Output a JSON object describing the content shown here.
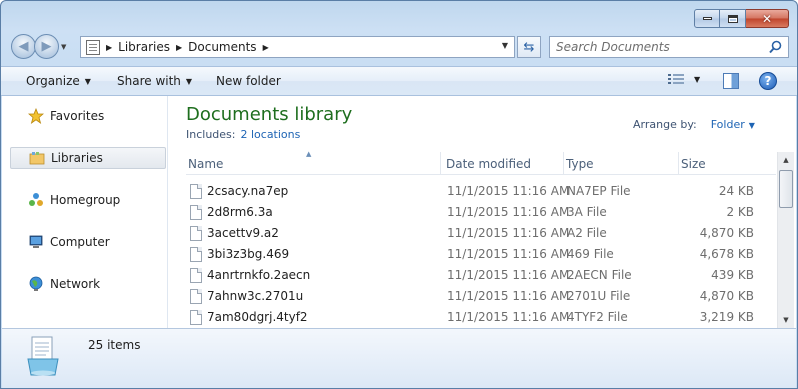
{
  "address": {
    "crumbs": [
      "Libraries",
      "Documents"
    ],
    "search_placeholder": "Search Documents"
  },
  "toolbar": {
    "organize": "Organize",
    "share_with": "Share with",
    "new_folder": "New folder"
  },
  "sidebar": {
    "items": [
      {
        "label": "Favorites",
        "icon": "star-icon"
      },
      {
        "label": "Libraries",
        "icon": "libraries-icon",
        "selected": true
      },
      {
        "label": "Homegroup",
        "icon": "homegroup-icon"
      },
      {
        "label": "Computer",
        "icon": "computer-icon"
      },
      {
        "label": "Network",
        "icon": "network-icon"
      }
    ]
  },
  "library": {
    "title": "Documents library",
    "includes_label": "Includes:",
    "includes_link": "2 locations",
    "arrange_label": "Arrange by:",
    "arrange_value": "Folder"
  },
  "columns": {
    "name": "Name",
    "date": "Date modified",
    "type": "Type",
    "size": "Size"
  },
  "files": [
    {
      "name": "2csacy.na7ep",
      "date": "11/1/2015 11:16 AM",
      "type": "NA7EP File",
      "size": "24 KB"
    },
    {
      "name": "2d8rm6.3a",
      "date": "11/1/2015 11:16 AM",
      "type": "3A File",
      "size": "2 KB"
    },
    {
      "name": "3acettv9.a2",
      "date": "11/1/2015 11:16 AM",
      "type": "A2 File",
      "size": "4,870 KB"
    },
    {
      "name": "3bi3z3bg.469",
      "date": "11/1/2015 11:16 AM",
      "type": "469 File",
      "size": "4,678 KB"
    },
    {
      "name": "4anrtrnkfo.2aecn",
      "date": "11/1/2015 11:16 AM",
      "type": "2AECN File",
      "size": "439 KB"
    },
    {
      "name": "7ahnw3c.2701u",
      "date": "11/1/2015 11:16 AM",
      "type": "2701U File",
      "size": "4,870 KB"
    },
    {
      "name": "7am80dgrj.4tyf2",
      "date": "11/1/2015 11:16 AM",
      "type": "4TYF2 File",
      "size": "3,219 KB"
    }
  ],
  "details": {
    "item_count": "25 items"
  }
}
